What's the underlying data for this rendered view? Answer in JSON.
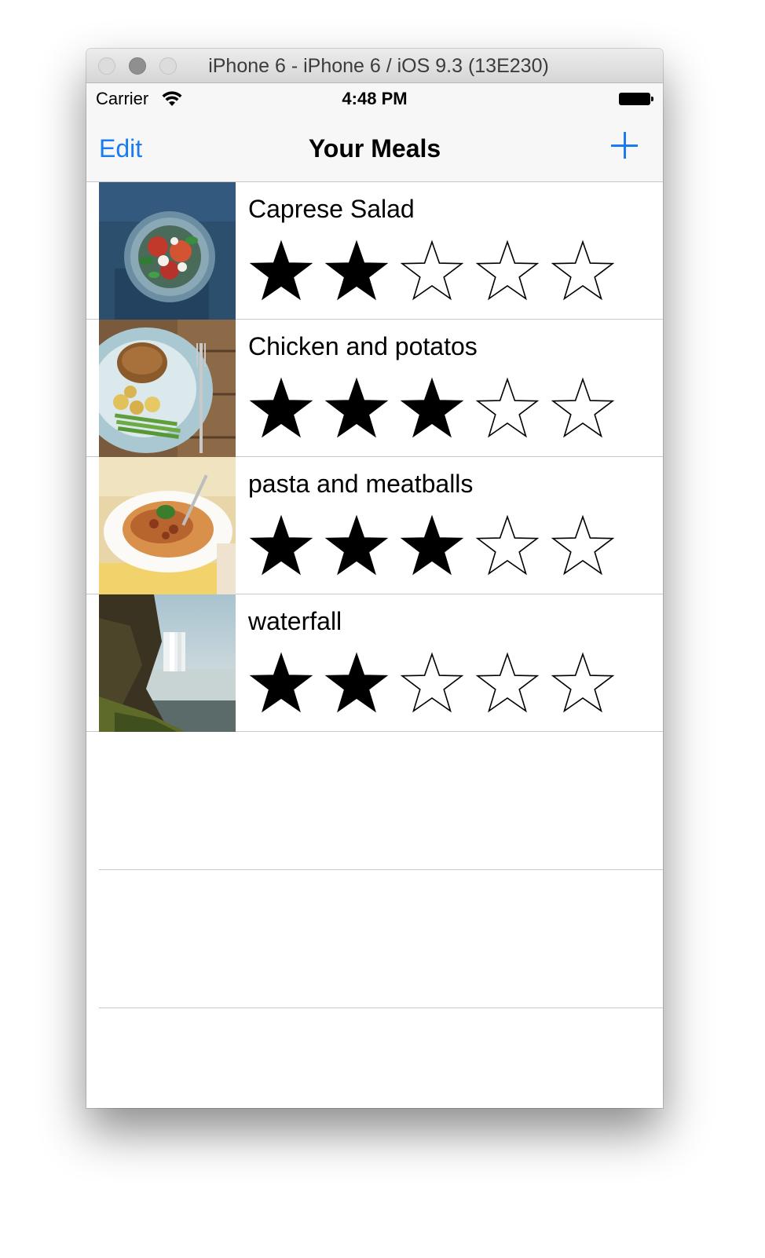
{
  "window": {
    "title": "iPhone 6 - iPhone 6 / iOS 9.3 (13E230)"
  },
  "status_bar": {
    "carrier": "Carrier",
    "wifi_icon": "wifi-icon",
    "time": "4:48 PM",
    "battery_icon": "battery-icon",
    "battery_level": 1.0
  },
  "nav_bar": {
    "left_button": "Edit",
    "title": "Your Meals",
    "right_button_icon": "plus-icon"
  },
  "meals": [
    {
      "name": "Caprese Salad",
      "rating": 2,
      "max_rating": 5,
      "photo": "caprese-salad-photo"
    },
    {
      "name": "Chicken and potatos",
      "rating": 3,
      "max_rating": 5,
      "photo": "chicken-potatoes-photo"
    },
    {
      "name": "pasta and meatballs",
      "rating": 3,
      "max_rating": 5,
      "photo": "pasta-meatballs-photo"
    },
    {
      "name": "waterfall",
      "rating": 2,
      "max_rating": 5,
      "photo": "waterfall-photo"
    }
  ],
  "colors": {
    "tint": "#1b7cf2",
    "separator": "#c8c7cc",
    "bar_background": "#f7f7f7",
    "star_fill": "#000000"
  }
}
